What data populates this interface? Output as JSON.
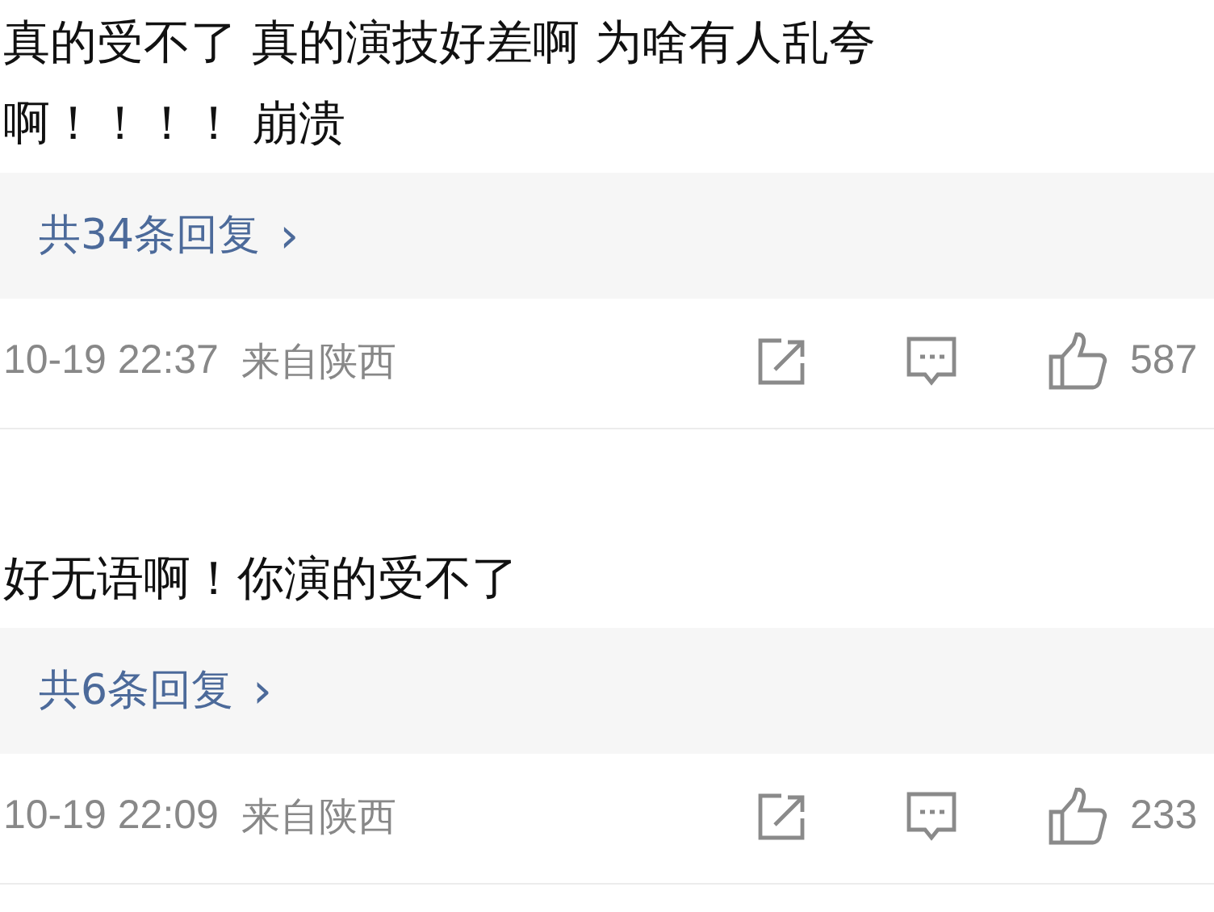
{
  "comments": [
    {
      "text": "真的受不了 真的演技好差啊 为啥有人乱夸啊！！！！ 崩溃",
      "replies": "共34条回复",
      "reply_arrow": "›",
      "time": "10-19 22:37",
      "location": "来自陕西",
      "likes": "587"
    },
    {
      "text": "好无语啊！你演的受不了",
      "replies": "共6条回复",
      "reply_arrow": "›",
      "time": "10-19 22:09",
      "location": "来自陕西",
      "likes": "233"
    }
  ]
}
